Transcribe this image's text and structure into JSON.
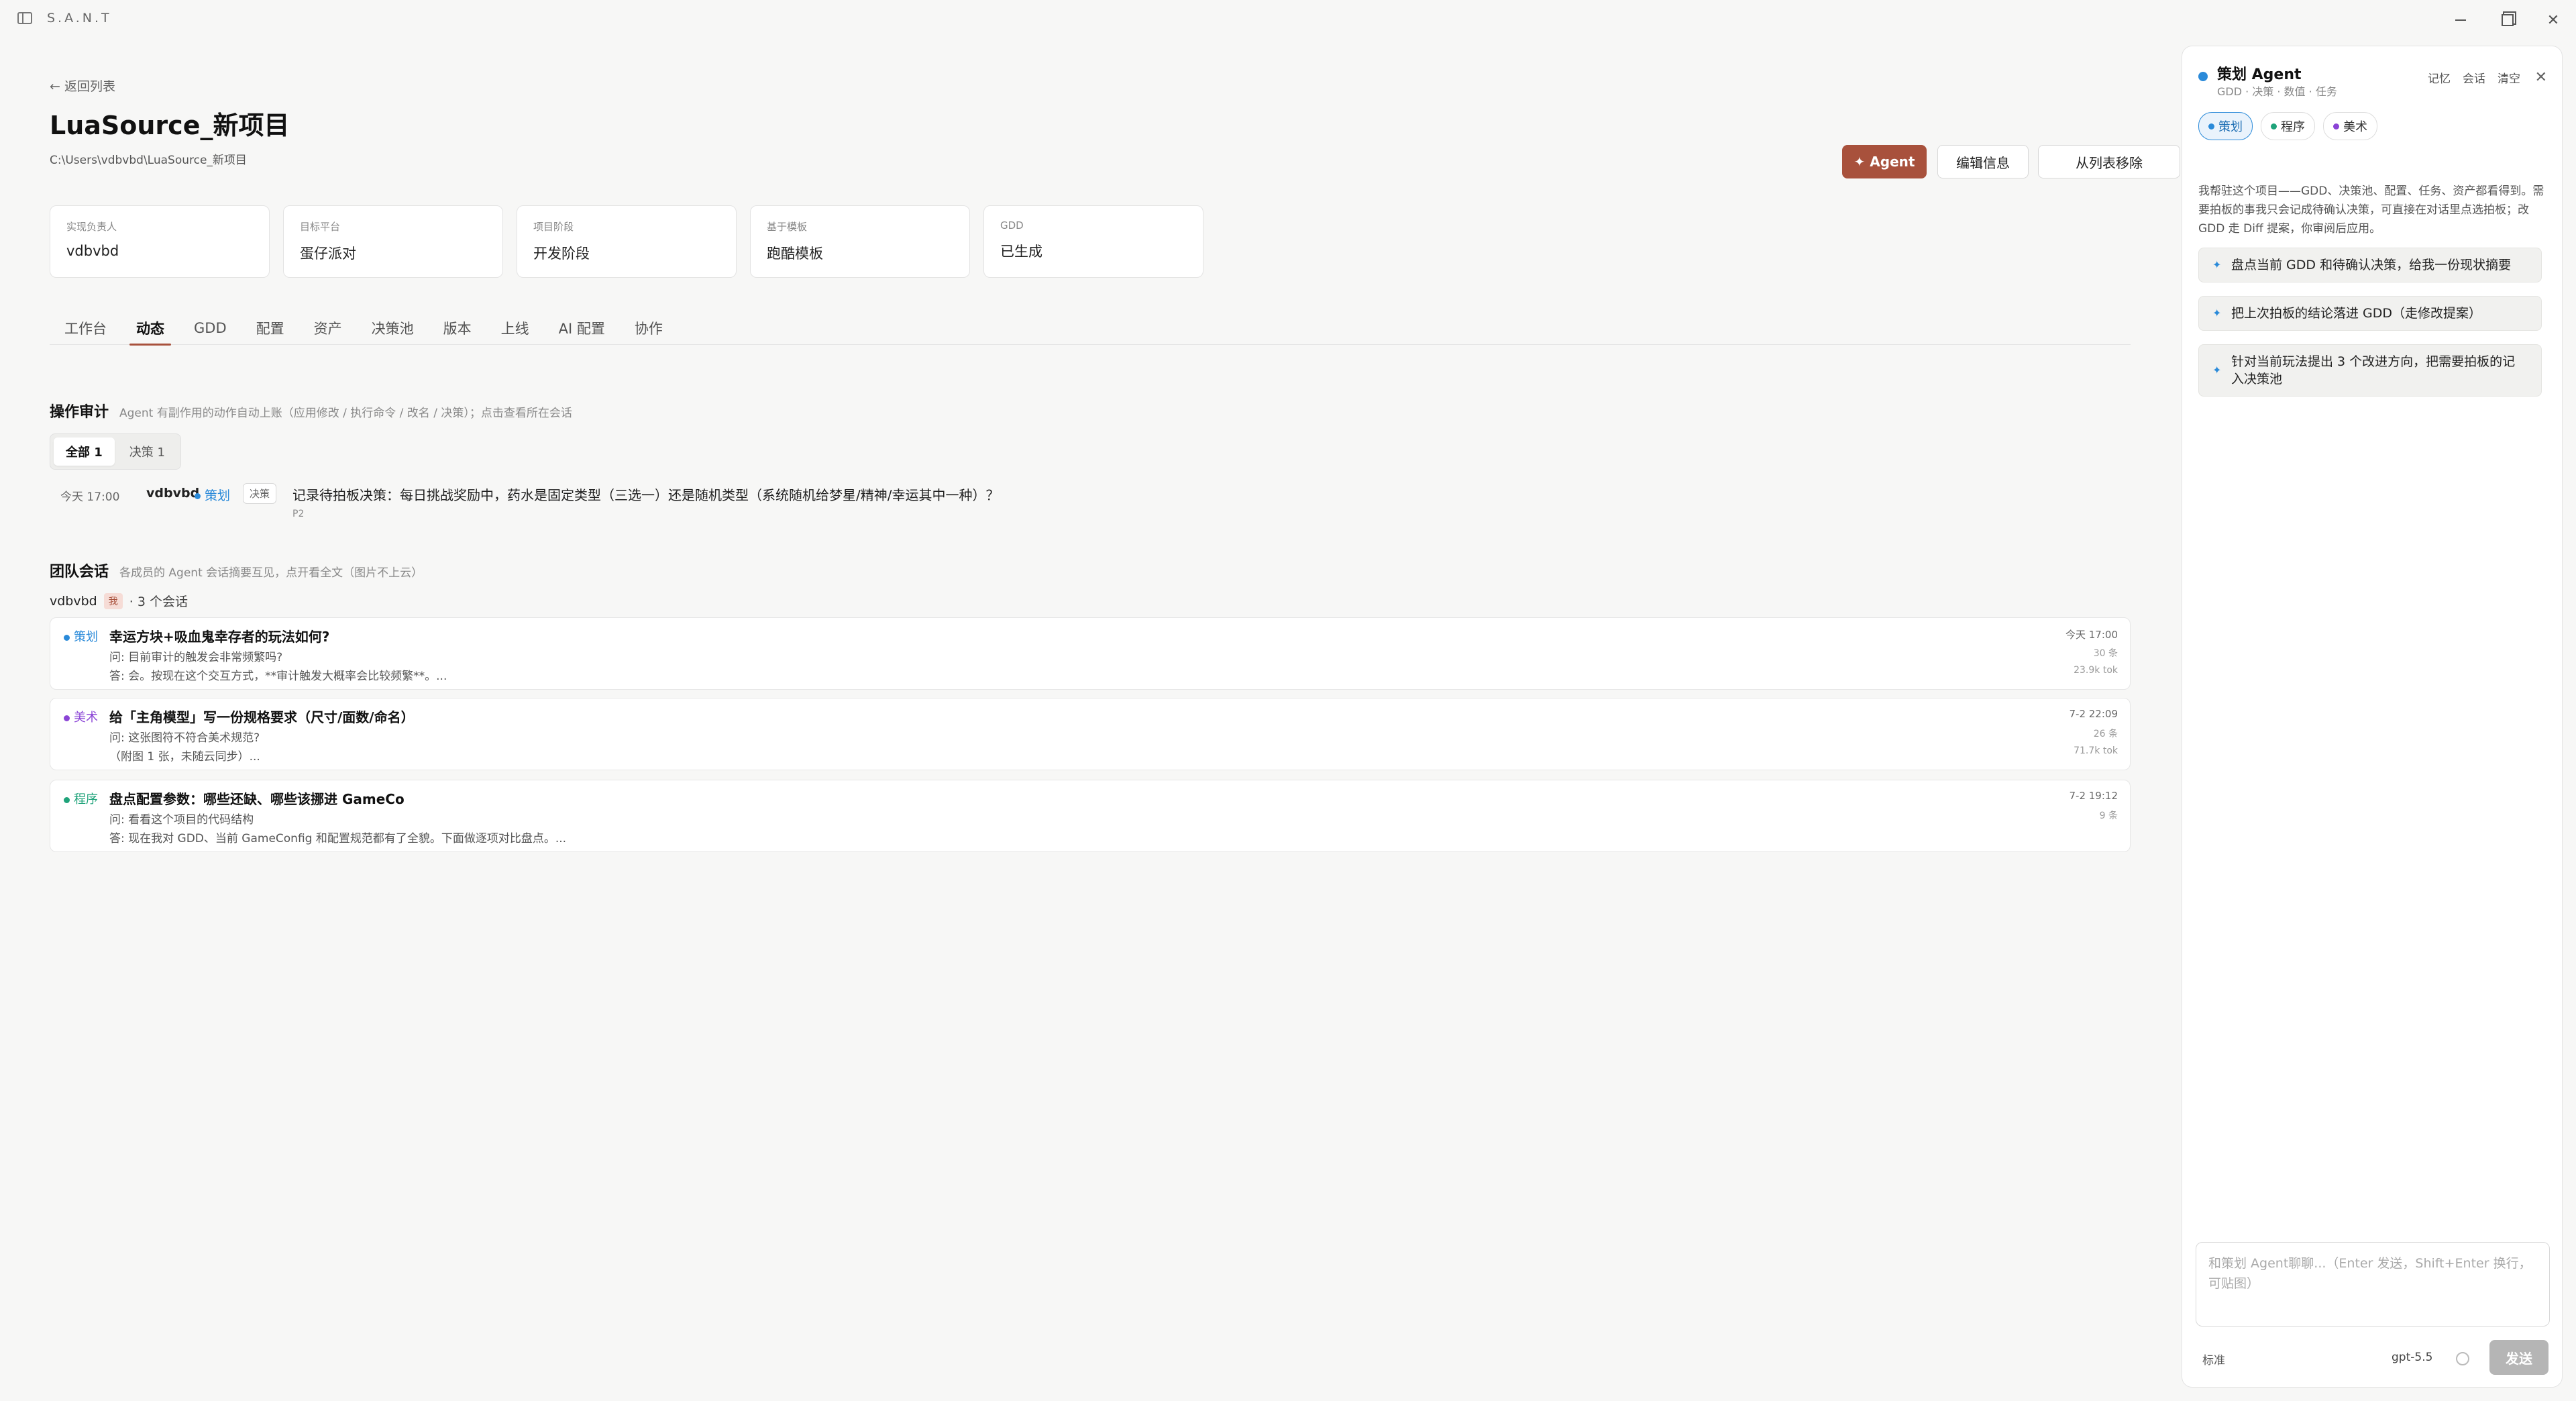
{
  "app": {
    "name": "S.A.N.T"
  },
  "header": {
    "back_label": "← 返回列表",
    "title": "LuaSource_新项目",
    "path": "C:\\Users\\vdbvbd\\LuaSource_新项目",
    "agent_btn": "✦ Agent",
    "edit_btn": "编辑信息",
    "remove_btn": "从列表移除"
  },
  "info_cards": [
    {
      "k": "实现负责人",
      "v": "vdbvbd"
    },
    {
      "k": "目标平台",
      "v": "蛋仔派对"
    },
    {
      "k": "项目阶段",
      "v": "开发阶段"
    },
    {
      "k": "基于模板",
      "v": "跑酷模板"
    },
    {
      "k": "GDD",
      "v": "已生成"
    }
  ],
  "tabs": [
    "工作台",
    "动态",
    "GDD",
    "配置",
    "资产",
    "决策池",
    "版本",
    "上线",
    "AI 配置",
    "协作"
  ],
  "audit": {
    "title": "操作审计",
    "subtitle": "Agent 有副作用的动作自动上账（应用修改 / 执行命令 / 改名 / 决策）；点击查看所在会话",
    "filters": [
      "全部 1",
      "决策 1"
    ],
    "row": {
      "time": "今天 17:00",
      "user": "vdbvbd",
      "role": "策划",
      "type": "决策",
      "text": "记录待拍板决策：每日挑战奖励中，药水是固定类型（三选一）还是随机类型（系统随机给梦星/精神/幸运其中一种）？",
      "priority": "P2"
    }
  },
  "team": {
    "title": "团队会话",
    "subtitle": "各成员的 Agent 会话摘要互见，点开看全文（图片不上云）",
    "user": "vdbvbd",
    "me": "我",
    "count": "· 3 个会话",
    "sessions": [
      {
        "role": "策划",
        "role_color": "#2a8ad9",
        "title": "幸运方块+吸血鬼幸存者的玩法如何?",
        "q": "问:  目前审计的触发会非常频繁吗?",
        "a": "答:  会。按现在这个交互方式，**审计触发大概率会比较频繁**。...",
        "time": "今天 17:00",
        "msgs": "30 条",
        "tok": "23.9k tok"
      },
      {
        "role": "美术",
        "role_color": "#8b44d6",
        "title": "给「主角模型」写一份规格要求（尺寸/面数/命名）",
        "q": "问:  这张图符不符合美术规范?",
        "a": "（附图 1 张，未随云同步）...",
        "time": "7-2 22:09",
        "msgs": "26 条",
        "tok": "71.7k tok"
      },
      {
        "role": "程序",
        "role_color": "#1fa37a",
        "title": "盘点配置参数：哪些还缺、哪些该挪进 GameCo",
        "q": "问:  看看这个项目的代码结构",
        "a": "答:  现在我对 GDD、当前 GameConfig 和配置规范都有了全貌。下面做逐项对比盘点。...",
        "time": "7-2 19:12",
        "msgs": "9 条",
        "tok": ""
      }
    ]
  },
  "agent_panel": {
    "title": "策划 Agent",
    "subtitle": "GDD · 决策 · 数值 · 任务",
    "actions": [
      "记忆",
      "会话",
      "清空"
    ],
    "roles": [
      {
        "label": "策划",
        "color": "#2a8ad9"
      },
      {
        "label": "程序",
        "color": "#1fa37a"
      },
      {
        "label": "美术",
        "color": "#8b44d6"
      }
    ],
    "intro": "我帮驻这个项目——GDD、决策池、配置、任务、资产都看得到。需要拍板的事我只会记成待确认决策，可直接在对话里点选拍板；改 GDD 走 Diff 提案，你审阅后应用。",
    "suggestions": [
      "盘点当前 GDD 和待确认决策，给我一份现状摘要",
      "把上次拍板的结论落进 GDD（走修改提案）",
      "针对当前玩法提出 3 个改进方向，把需要拍板的记入决策池"
    ],
    "input_placeholder": "和策划 Agent聊聊...（Enter 发送，Shift+Enter 换行，可贴图）",
    "mode": "标准",
    "model": "gpt-5.5",
    "send": "发送"
  },
  "colors": {
    "accent": "#a8513c",
    "planner": "#2a8ad9",
    "programmer": "#1fa37a",
    "artist": "#8b44d6"
  }
}
